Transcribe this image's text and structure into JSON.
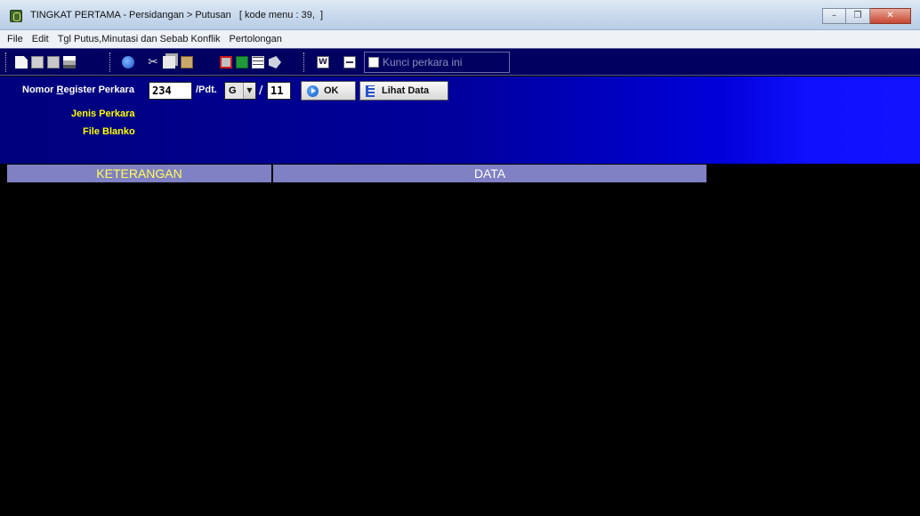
{
  "window": {
    "title": "TINGKAT PERTAMA - Persidangan > Putusan   [ kode menu : 39,  ]"
  },
  "menu": {
    "items": [
      "File",
      "Edit",
      "Tgl Putus,Minutasi dan Sebab Konflik",
      "Pertolongan"
    ]
  },
  "toolbar": {
    "lock_label": "Kunci perkara ini"
  },
  "form": {
    "register_label_pre": "Nomor ",
    "register_label_underline": "R",
    "register_label_post": "egister Perkara",
    "register_number": "234",
    "pdt_label": "/Pdt.",
    "case_type_value": "G",
    "slash": "/",
    "year_value": "11",
    "ok_label": "OK",
    "lihat_label": "Lihat Data",
    "jenis_label": "Jenis Perkara",
    "file_label": "File Blanko"
  },
  "grid": {
    "col_keterangan": "KETERANGAN",
    "col_data": "DATA"
  }
}
